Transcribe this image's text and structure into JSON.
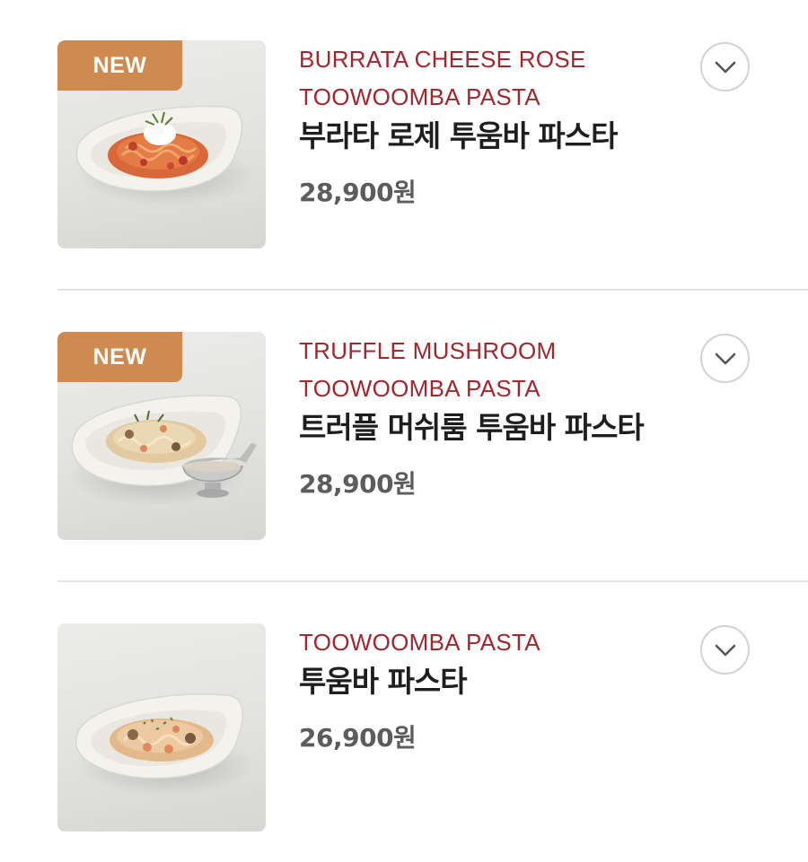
{
  "menu": {
    "items": [
      {
        "badge": "NEW",
        "name_en_line1": "BURRATA CHEESE ROSE",
        "name_en_line2": "TOOWOOMBA PASTA",
        "name_ko": "부라타 로제 투움바 파스타",
        "price": "28,900원",
        "image_icon": "rose-pasta-plate-photo",
        "expand_icon": "chevron-down-icon"
      },
      {
        "badge": "NEW",
        "name_en_line1": "TRUFFLE MUSHROOM",
        "name_en_line2": "TOOWOOMBA PASTA",
        "name_ko": "트러플 머쉬룸 투움바 파스타",
        "price": "28,900원",
        "image_icon": "truffle-pasta-plate-photo",
        "expand_icon": "chevron-down-icon"
      },
      {
        "name_en_line1": "TOOWOOMBA PASTA",
        "name_ko": "투움바 파스타",
        "price": "26,900원",
        "image_icon": "toowoomba-pasta-plate-photo",
        "expand_icon": "chevron-down-icon"
      }
    ]
  },
  "colors": {
    "en_name": "#a3262f",
    "badge_bg": "#cf8a4f",
    "price_text": "#5c5c5c",
    "divider": "#e3e3e3"
  }
}
